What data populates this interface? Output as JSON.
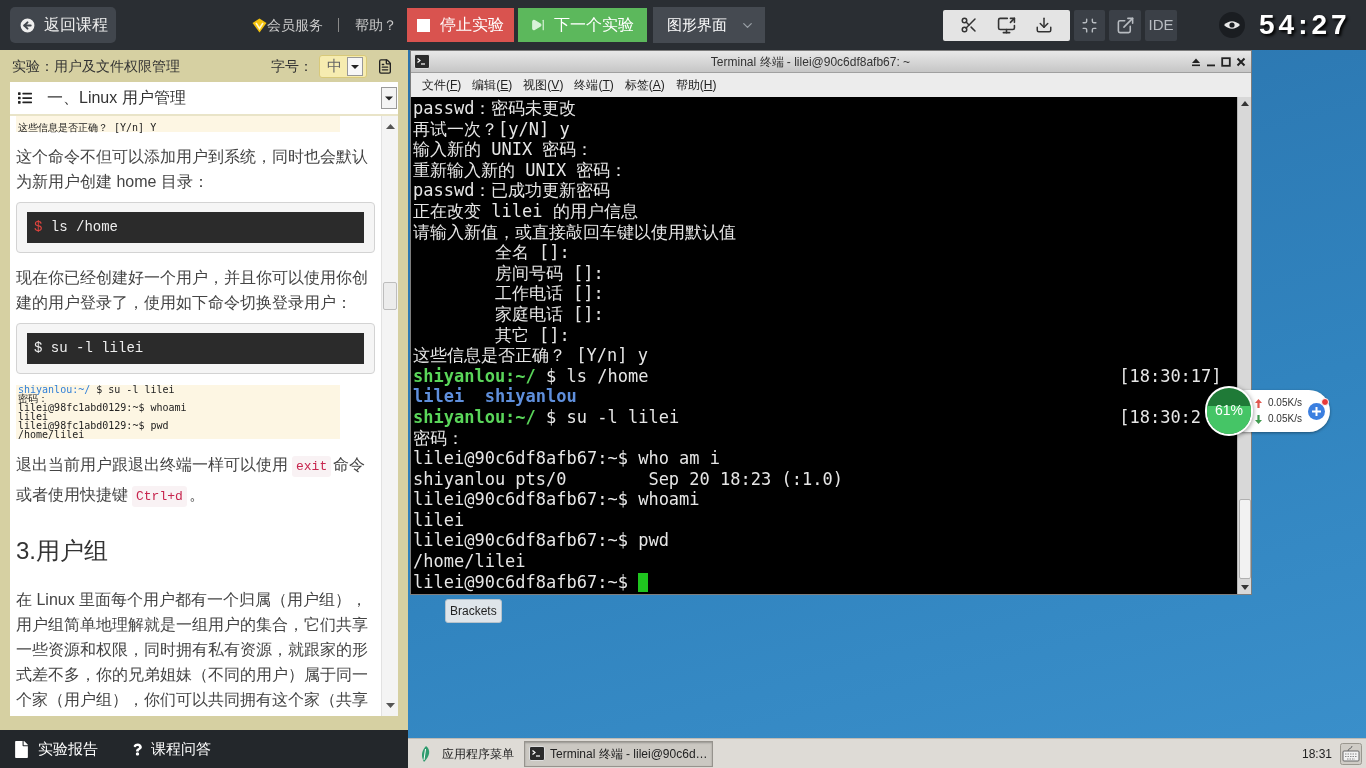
{
  "top_bar": {
    "back_button": "返回课程",
    "member_link": "会员服务",
    "help_link": "帮助？",
    "stop_button": "停止实验",
    "next_button": "下一个实验",
    "mode_select": "图形界面",
    "ide_button": "IDE",
    "timer": "54:27"
  },
  "lesson_panel": {
    "title": "实验：用户及文件权限管理",
    "font_size_label": "字号：",
    "font_size": "中",
    "toc": "一、Linux 用户管理",
    "content": [
      {
        "kind": "screenshot",
        "lines": [
          {
            "text": "这些信息是否正确？ [Y/n] Y"
          }
        ]
      },
      {
        "kind": "paragraph",
        "segments": [
          {
            "kind": "text",
            "text": "这个命令不但可以添加用户到系统，同时也会默认为新用户创建 home 目录："
          }
        ]
      },
      {
        "kind": "code",
        "prompt": "$",
        "command": "ls /home",
        "prompt_highlighted": true
      },
      {
        "kind": "paragraph",
        "segments": [
          {
            "kind": "text",
            "text": "现在你已经创建好一个用户，并且你可以使用你创建的用户登录了，使用如下命令切换登录用户："
          }
        ]
      },
      {
        "kind": "code",
        "prompt": "$",
        "command": "su -l lilei",
        "prompt_highlighted": false
      },
      {
        "kind": "screenshot",
        "lines": [
          {
            "prompt": "shiyanlou:~/",
            "text": "$ su -l lilei"
          },
          {
            "text": "密码："
          },
          {
            "text": "lilei@98fc1abd0129:~$ whoami"
          },
          {
            "text": "lilei"
          },
          {
            "text": "lilei@98fc1abd0129:~$ pwd"
          },
          {
            "text": "/home/lilei"
          }
        ]
      },
      {
        "kind": "paragraph",
        "segments": [
          {
            "kind": "text",
            "text": "退出当前用户跟退出终端一样可以使用"
          },
          {
            "kind": "code",
            "text": "exit"
          },
          {
            "kind": "text",
            "text": "命令或者使用快捷键"
          },
          {
            "kind": "code",
            "text": "Ctrl+d"
          },
          {
            "kind": "text",
            "text": "。"
          }
        ]
      },
      {
        "kind": "heading",
        "text": "3.用户组"
      },
      {
        "kind": "paragraph",
        "segments": [
          {
            "kind": "text",
            "text": "在 Linux 里面每个用户都有一个归属（用户组），用户组简单地理解就是一组用户的集合，它们共享一些资源和权限，同时拥有私有资源，就跟家的形式差不多，你的兄弟姐妹（不同的用户）属于同一个家（用户组），你们可以共同拥有这个家（共享"
          }
        ]
      }
    ],
    "footer_links": [
      {
        "kind": "report",
        "label": "实验报告"
      },
      {
        "kind": "qa",
        "label": "课程问答"
      }
    ]
  },
  "terminal": {
    "title": "Terminal 终端 - lilei@90c6df8afb67: ~",
    "menu": [
      {
        "text": "文件(",
        "key": "F",
        "tail": ")"
      },
      {
        "text": "编辑(",
        "key": "E",
        "tail": ")"
      },
      {
        "text": "视图(",
        "key": "V",
        "tail": ")"
      },
      {
        "text": "终端(",
        "key": "T",
        "tail": ")"
      },
      {
        "text": "标签(",
        "key": "A",
        "tail": ")"
      },
      {
        "text": "帮助(",
        "key": "H",
        "tail": ")"
      }
    ],
    "lines": [
      {
        "kind": "output",
        "text": "passwd：密码未更改"
      },
      {
        "kind": "output",
        "text": "再试一次？[y/N] y"
      },
      {
        "kind": "output",
        "text": "输入新的 UNIX 密码："
      },
      {
        "kind": "output",
        "text": "重新输入新的 UNIX 密码："
      },
      {
        "kind": "output",
        "text": "passwd：已成功更新密码"
      },
      {
        "kind": "output",
        "text": "正在改变 lilei 的用户信息"
      },
      {
        "kind": "output",
        "text": "请输入新值，或直接敲回车键以使用默认值"
      },
      {
        "kind": "field",
        "text": "全名 []:"
      },
      {
        "kind": "field",
        "text": "房间号码 []:"
      },
      {
        "kind": "field",
        "text": "工作电话 []:"
      },
      {
        "kind": "field",
        "text": "家庭电话 []:"
      },
      {
        "kind": "field",
        "text": "其它 []:"
      },
      {
        "kind": "output",
        "text": "这些信息是否正确？ [Y/n] y"
      },
      {
        "kind": "prompt",
        "prompt": "shiyanlou:~/",
        "text": "$ ls /home",
        "timestamp": "[18:30:17]"
      },
      {
        "kind": "listing",
        "text": "lilei  shiyanlou"
      },
      {
        "kind": "prompt",
        "prompt": "shiyanlou:~/",
        "text": "$ su -l lilei",
        "timestamp": "[18:30:2"
      },
      {
        "kind": "output",
        "text": "密码："
      },
      {
        "kind": "output",
        "text": "lilei@90c6df8afb67:~$ who am i"
      },
      {
        "kind": "output",
        "text": "shiyanlou pts/0        Sep 20 18:23 (:1.0)"
      },
      {
        "kind": "output",
        "text": "lilei@90c6df8afb67:~$ whoami"
      },
      {
        "kind": "output",
        "text": "lilei"
      },
      {
        "kind": "output",
        "text": "lilei@90c6df8afb67:~$ pwd"
      },
      {
        "kind": "output",
        "text": "/home/lilei"
      },
      {
        "kind": "cursor",
        "text": "lilei@90c6df8afb67:~$"
      }
    ]
  },
  "desktop": {
    "icons": [
      "Brackets"
    ]
  },
  "net_monitor": {
    "level": 0.61,
    "reading": "61%",
    "upload": "0.05K/s",
    "download": "0.05K/s"
  },
  "taskbar": {
    "menu_button": "应用程序菜单",
    "tasks": [
      {
        "label": "Terminal 终端 - lilei@90c6d…",
        "selected": true
      }
    ],
    "clock": "18:31"
  }
}
